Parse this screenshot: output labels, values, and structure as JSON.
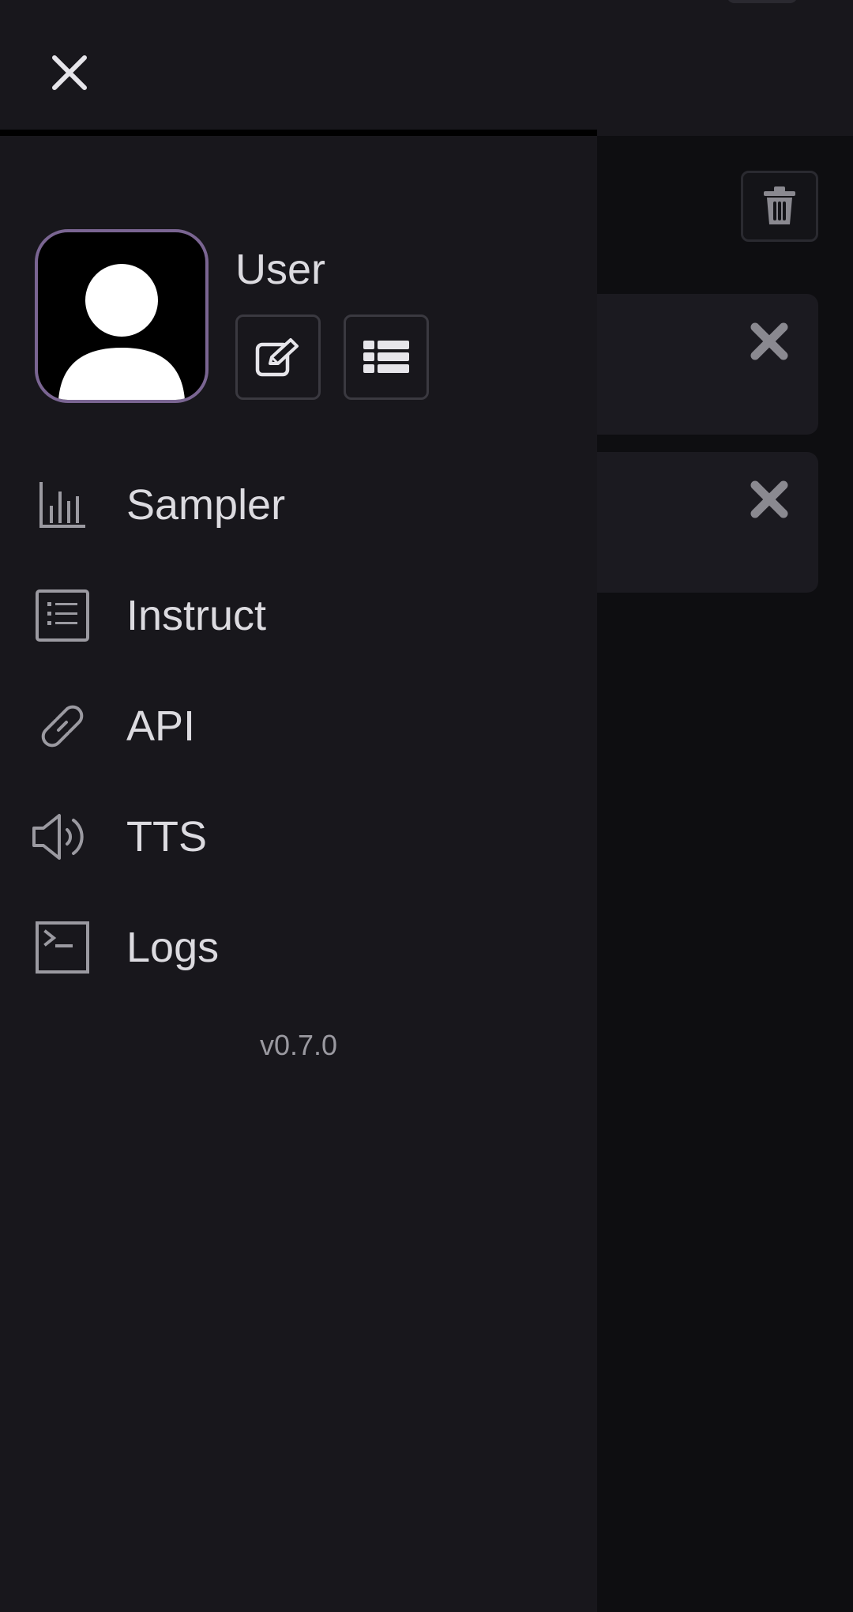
{
  "user": {
    "name": "User"
  },
  "menu": {
    "items": [
      {
        "label": "Sampler",
        "icon": "bar-chart-icon"
      },
      {
        "label": "Instruct",
        "icon": "list-document-icon"
      },
      {
        "label": "API",
        "icon": "link-icon"
      },
      {
        "label": "TTS",
        "icon": "speaker-icon"
      },
      {
        "label": "Logs",
        "icon": "terminal-icon"
      }
    ]
  },
  "version": "v0.7.0",
  "colors": {
    "drawer_bg": "#18171c",
    "app_bg": "#0e0e11",
    "text": "#dcdbe0",
    "avatar_border": "#7a6592",
    "muted": "#9a99a0"
  }
}
